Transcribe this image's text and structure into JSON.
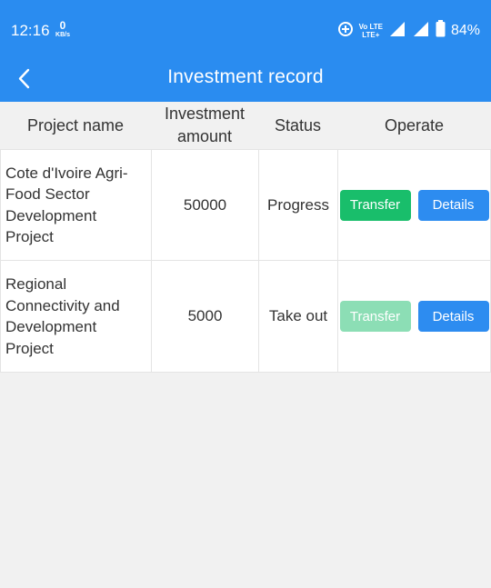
{
  "status_bar": {
    "time": "12:16",
    "speed_value": "0",
    "speed_unit": "KB/s",
    "net_top": "Vo LTE",
    "net_bottom": "LTE+",
    "battery_percent": "84%"
  },
  "header": {
    "title": "Investment record"
  },
  "table": {
    "columns": {
      "project": "Project name",
      "amount": "Investment amount",
      "status": "Status",
      "operate": "Operate"
    },
    "rows": [
      {
        "name": "Cote d'Ivoire Agri-Food Sector Development Project",
        "amount": "50000",
        "status": "Progress",
        "transfer_label": "Transfer",
        "details_label": "Details"
      },
      {
        "name": "Regional Connectivity and Development Project",
        "amount": "5000",
        "status": "Take out",
        "transfer_label": "Transfer",
        "details_label": "Details"
      }
    ]
  },
  "colors": {
    "primary": "#2a8cf0",
    "transfer_active": "#19be6b",
    "transfer_disabled": "#8cdeb5"
  }
}
